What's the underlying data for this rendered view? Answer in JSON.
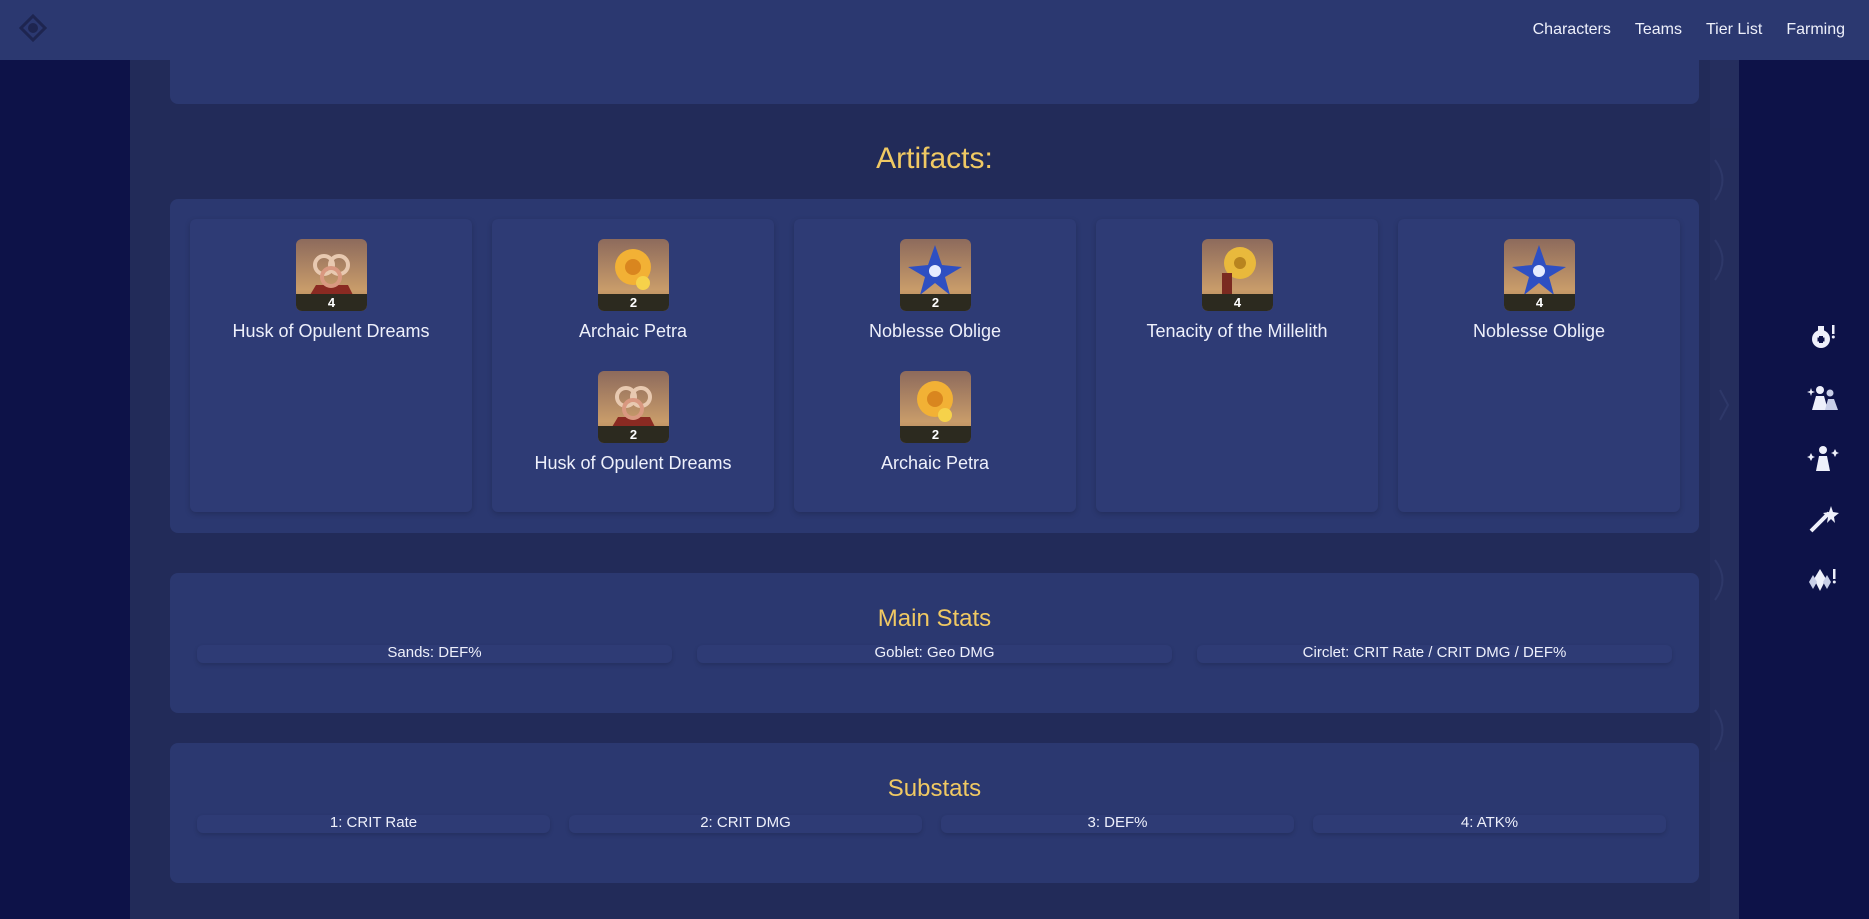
{
  "nav": {
    "links": [
      "Characters",
      "Teams",
      "Tier List",
      "Farming"
    ]
  },
  "artifacts": {
    "title": "Artifacts:",
    "columns": [
      {
        "items": [
          {
            "name": "Husk of Opulent Dreams",
            "count": "4",
            "icon": "husk-icon"
          }
        ]
      },
      {
        "items": [
          {
            "name": "Archaic Petra",
            "count": "2",
            "icon": "petra-icon"
          },
          {
            "name": "Husk of Opulent Dreams",
            "count": "2",
            "icon": "husk-icon"
          }
        ]
      },
      {
        "items": [
          {
            "name": "Noblesse Oblige",
            "count": "2",
            "icon": "noblesse-icon"
          },
          {
            "name": "Archaic Petra",
            "count": "2",
            "icon": "petra-icon"
          }
        ]
      },
      {
        "items": [
          {
            "name": "Tenacity of the Millelith",
            "count": "4",
            "icon": "millelith-icon"
          }
        ]
      },
      {
        "items": [
          {
            "name": "Noblesse Oblige",
            "count": "4",
            "icon": "noblesse-icon"
          }
        ]
      }
    ]
  },
  "main_stats": {
    "title": "Main Stats",
    "items": [
      "Sands: DEF%",
      "Goblet: Geo DMG",
      "Circlet: CRIT Rate / CRIT DMG / DEF%"
    ]
  },
  "substats": {
    "title": "Substats",
    "items": [
      "1: CRIT Rate",
      "2: CRIT DMG",
      "3: DEF%",
      "4: ATK%"
    ]
  },
  "side_icons": [
    "potion-icon",
    "character-group-icon",
    "character-sparkle-icon",
    "wish-star-icon",
    "crystal-icon"
  ],
  "colors": {
    "accent": "#f0c963",
    "panel": "#2b3870",
    "background": "#0d1248"
  }
}
